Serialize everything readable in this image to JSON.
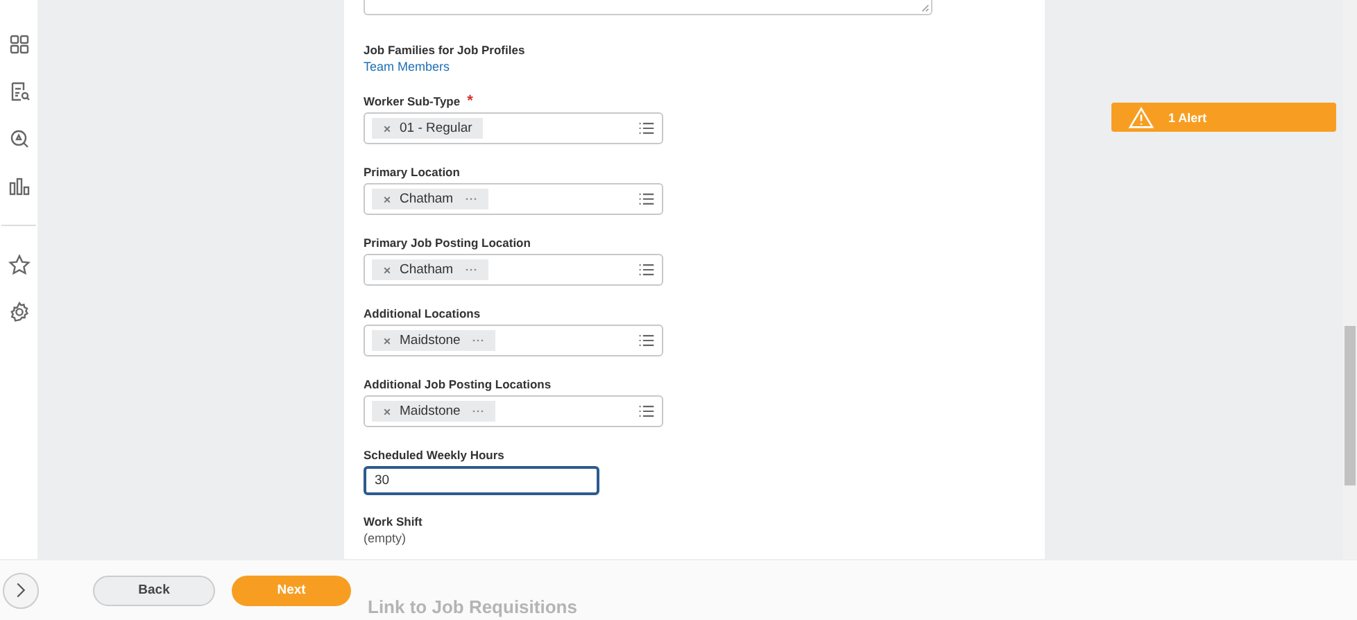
{
  "fields": [
    {
      "kind": "text",
      "label": "Job Families for Job Profiles",
      "value": "Team Members",
      "link": true
    },
    {
      "kind": "multiselect",
      "label": "Worker Sub-Type",
      "required_mark": "*",
      "chips": [
        {
          "text": "01 - Regular",
          "more": false
        }
      ]
    },
    {
      "kind": "multiselect",
      "label": "Primary Location",
      "chips": [
        {
          "text": "Chatham",
          "more": true
        }
      ]
    },
    {
      "kind": "multiselect",
      "label": "Primary Job Posting Location",
      "chips": [
        {
          "text": "Chatham",
          "more": true
        }
      ]
    },
    {
      "kind": "multiselect",
      "label": "Additional Locations",
      "chips": [
        {
          "text": "Maidstone",
          "more": true
        }
      ]
    },
    {
      "kind": "multiselect",
      "label": "Additional Job Posting Locations",
      "chips": [
        {
          "text": "Maidstone",
          "more": true
        }
      ]
    },
    {
      "kind": "input",
      "label": "Scheduled Weekly Hours",
      "value": "30",
      "focused": true
    },
    {
      "kind": "text",
      "label": "Work Shift",
      "value": "(empty)",
      "link": false
    }
  ],
  "alert": {
    "text": "1 Alert"
  },
  "footer": {
    "buttons": [
      {
        "label": "Back",
        "kind": "secondary"
      },
      {
        "label": "Next",
        "kind": "primary"
      }
    ],
    "next_section_heading": "Link to Job Requisitions"
  }
}
